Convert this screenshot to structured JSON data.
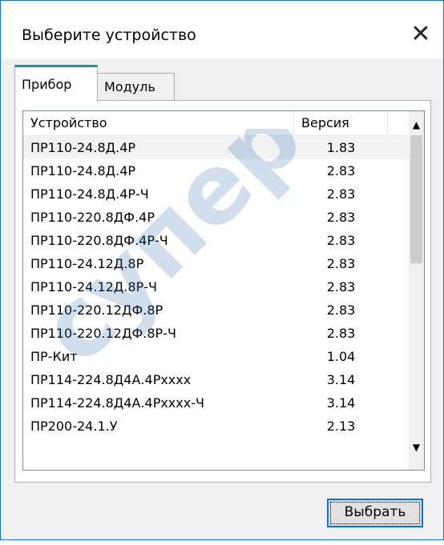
{
  "window": {
    "title": "Выберите устройство",
    "close_glyph": "✕"
  },
  "tabs": [
    {
      "label": "Прибор",
      "active": true
    },
    {
      "label": "Модуль",
      "active": false
    }
  ],
  "table": {
    "columns": [
      "Устройство",
      "Версия"
    ],
    "rows": [
      {
        "device": "ПР110-24.8Д.4Р",
        "version": "1.83"
      },
      {
        "device": "ПР110-24.8Д.4Р",
        "version": "2.83"
      },
      {
        "device": "ПР110-24.8Д.4Р-Ч",
        "version": "2.83"
      },
      {
        "device": "ПР110-220.8ДФ.4Р",
        "version": "2.83"
      },
      {
        "device": "ПР110-220.8ДФ.4Р-Ч",
        "version": "2.83"
      },
      {
        "device": "ПР110-24.12Д.8Р",
        "version": "2.83"
      },
      {
        "device": "ПР110-24.12Д.8Р-Ч",
        "version": "2.83"
      },
      {
        "device": "ПР110-220.12ДФ.8Р",
        "version": "2.83"
      },
      {
        "device": "ПР110-220.12ДФ.8Р-Ч",
        "version": "2.83"
      },
      {
        "device": "ПР-Кит",
        "version": "1.04"
      },
      {
        "device": "ПР114-224.8Д4А.4Рxxxx",
        "version": "3.14"
      },
      {
        "device": "ПР114-224.8Д4А.4Рxxxx-Ч",
        "version": "3.14"
      },
      {
        "device": "ПР200-24.1.У",
        "version": "2.13"
      }
    ],
    "scroll_up_glyph": "▲",
    "scroll_down_glyph": "▼"
  },
  "buttons": {
    "select_label": "Выбрать"
  },
  "watermark": {
    "text": "супер",
    "color": "#2c6fb5"
  },
  "colors": {
    "accent": "#0078d7",
    "tab_accent": "#0f9ca0",
    "border": "#1e73c8"
  }
}
